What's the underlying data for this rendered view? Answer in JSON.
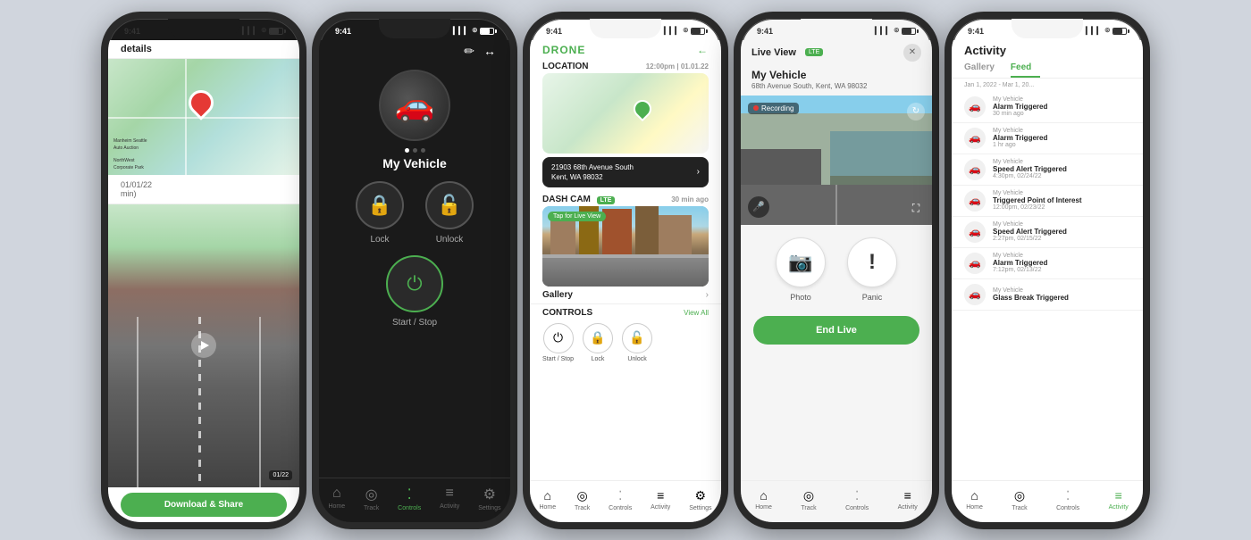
{
  "app": {
    "time": "9:41",
    "signal_bars": "▎▎▎▊",
    "wifi": "wifi",
    "battery": "battery"
  },
  "phone1": {
    "title": "details",
    "date": "01/01/22",
    "speed": "min)",
    "download_btn": "Download & Share"
  },
  "phone2": {
    "vehicle_name": "My Vehicle",
    "lock_label": "Lock",
    "unlock_label": "Unlock",
    "start_stop_label": "Start / Stop",
    "nav": {
      "home": "Home",
      "track": "Track",
      "controls": "Controls",
      "activity": "Activity",
      "settings": "Settings"
    }
  },
  "phone3": {
    "app_name": "DRONE",
    "location_title": "LOCATION",
    "location_time": "12:00pm | 01.01.22",
    "dash_cam_title": "DASH CAM",
    "dash_cam_badge": "LTE",
    "dash_cam_time": "30 min ago",
    "tap_live": "Tap for Live View",
    "address_line1": "21903 68th Avenue South",
    "address_line2": "Kent, WA 98032",
    "gallery_label": "Gallery",
    "controls_title": "CONTROLS",
    "view_all": "View All",
    "ctrl_start": "Start / Stop",
    "ctrl_lock": "Lock",
    "ctrl_unlock": "Unlock",
    "nav": {
      "home": "Home",
      "track": "Track",
      "controls": "Controls",
      "activity": "Activity",
      "settings": "Settings"
    }
  },
  "phone4": {
    "live_view_label": "Live View",
    "lte_badge": "LTE",
    "vehicle_name": "My Vehicle",
    "vehicle_address": "68th Avenue South, Kent, WA 98032",
    "recording_label": "Recording",
    "photo_label": "Photo",
    "panic_label": "Panic",
    "end_live_btn": "End Live",
    "nav": {
      "home": "Home",
      "track": "Track",
      "controls": "Controls",
      "activity": "Activity"
    }
  },
  "phone5": {
    "activity_title": "Activity",
    "tab_gallery": "Gallery",
    "tab_feed": "Feed",
    "date_range": "Jan 1, 2022 - Mar 1, 20...",
    "items": [
      {
        "vehicle": "My Vehicle",
        "event": "Alarm Triggered",
        "time": "30 min ago"
      },
      {
        "vehicle": "My Vehicle",
        "event": "Alarm Triggered",
        "time": "1 hr ago"
      },
      {
        "vehicle": "My Vehicle",
        "event": "Speed Alert Triggered",
        "time": "4:30pm, 02/24/22"
      },
      {
        "vehicle": "My Vehicle",
        "event": "Triggered Point of Interest",
        "time": "12:00pm, 02/23/22"
      },
      {
        "vehicle": "My Vehicle",
        "event": "Speed Alert Triggered",
        "time": "2:27pm, 02/15/22"
      },
      {
        "vehicle": "My Vehicle",
        "event": "Alarm Triggered",
        "time": "7:12pm, 02/13/22"
      },
      {
        "vehicle": "My Vehicle",
        "event": "Glass Break Triggered",
        "time": ""
      }
    ],
    "nav": {
      "home": "Home",
      "track": "Track",
      "controls": "Controls",
      "activity": "Activity"
    }
  }
}
